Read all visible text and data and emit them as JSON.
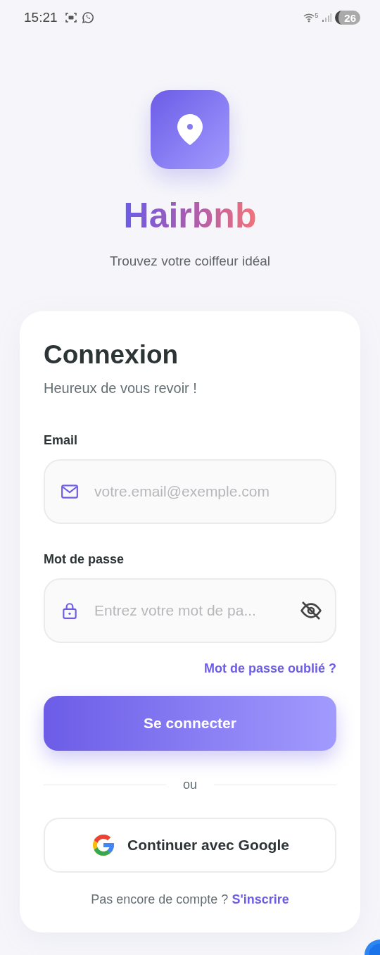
{
  "status_bar": {
    "time": "15:21",
    "network": "5",
    "battery": "26"
  },
  "brand": {
    "name": "Hairbnb",
    "tagline": "Trouvez votre coiffeur idéal"
  },
  "login": {
    "title": "Connexion",
    "subtitle": "Heureux de vous revoir !",
    "fields": [
      {
        "kind": "email",
        "label": "Email",
        "placeholder": "votre.email@exemple.com"
      },
      {
        "kind": "password",
        "label": "Mot de passe",
        "placeholder": "Entrez votre mot de pa...",
        "masked": true
      }
    ],
    "forgot_link": "Mot de passe oublié ?",
    "submit": "Se connecter",
    "divider": "ou",
    "google_button": "Continuer avec Google",
    "signup_prompt": "Pas encore de compte ?",
    "signup_link": "S'inscrire"
  }
}
